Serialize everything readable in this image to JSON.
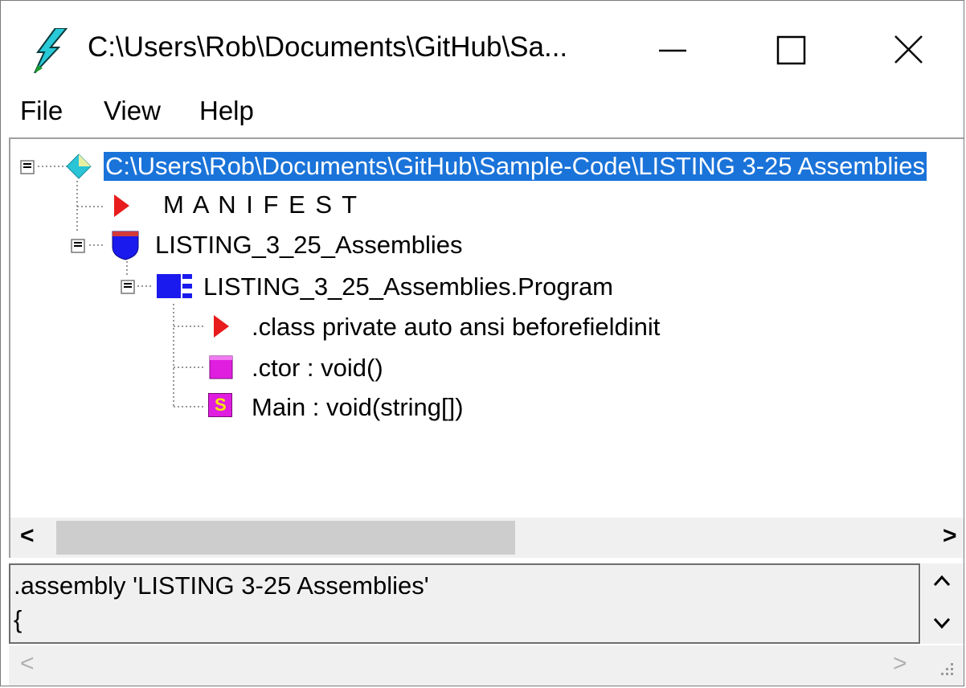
{
  "window": {
    "title": "C:\\Users\\Rob\\Documents\\GitHub\\Sa...",
    "icon": "lightning-icon"
  },
  "menu": {
    "file": "File",
    "view": "View",
    "help": "Help"
  },
  "tree": {
    "root": "C:\\Users\\Rob\\Documents\\GitHub\\Sample-Code\\LISTING 3-25 Assemblies",
    "manifest": "M A N I F E S T",
    "namespace": "LISTING_3_25_Assemblies",
    "class": "LISTING_3_25_Assemblies.Program",
    "class_info": ".class private auto ansi beforefieldinit",
    "ctor": ".ctor : void()",
    "main": "Main : void(string[])",
    "static_badge": "S"
  },
  "detail": {
    "line1": ".assembly 'LISTING 3-25 Assemblies'",
    "line2": "{"
  },
  "colors": {
    "selection": "#1a73d9",
    "manifest_arrow": "#e81c1c",
    "class_blue": "#1a1aee",
    "method_magenta": "#e01ee0",
    "root_diamond": "#29c4d6"
  }
}
